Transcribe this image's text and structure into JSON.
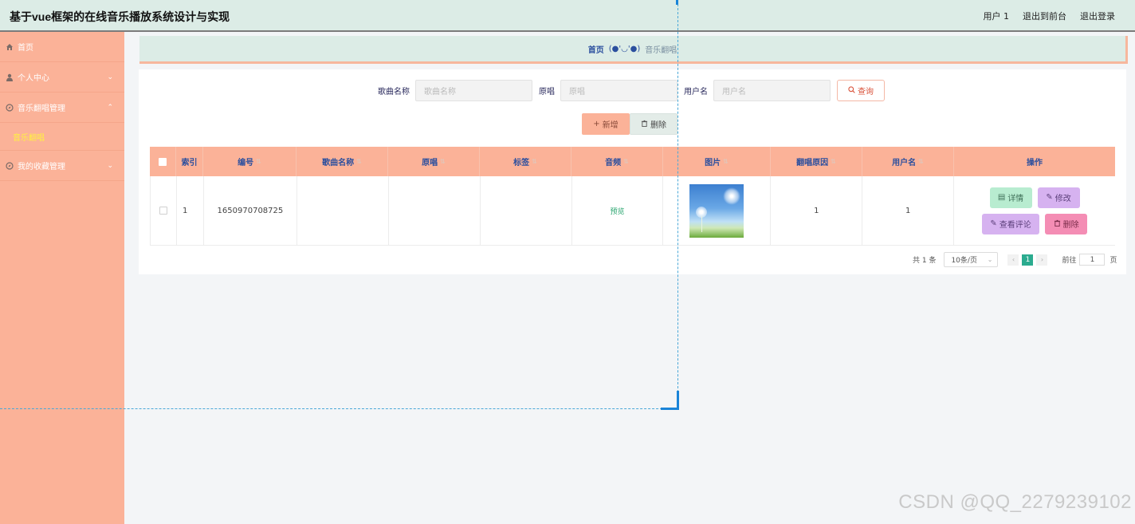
{
  "header": {
    "title": "基于vue框架的在线音乐播放系统设计与实现",
    "user": "用户 1",
    "to_front": "退出到前台",
    "logout": "退出登录"
  },
  "sidebar": {
    "items": [
      {
        "label": "首页",
        "icon": "home-icon"
      },
      {
        "label": "个人中心",
        "icon": "user-icon"
      },
      {
        "label": "音乐翻唱管理",
        "icon": "compass-icon"
      },
      {
        "label": "音乐翻唱",
        "icon": ""
      },
      {
        "label": "我的收藏管理",
        "icon": "compass-icon"
      }
    ]
  },
  "breadcrumb": {
    "home": "首页",
    "separator": "(●'◡'●)",
    "current": "音乐翻唱"
  },
  "search": {
    "song_label": "歌曲名称",
    "song_placeholder": "歌曲名称",
    "original_label": "原唱",
    "original_placeholder": "原唱",
    "user_label": "用户名",
    "user_placeholder": "用户名",
    "query_label": "查询"
  },
  "actions": {
    "add_label": "新增",
    "delete_label": "删除"
  },
  "table": {
    "columns": [
      "索引",
      "编号",
      "歌曲名称",
      "原唱",
      "标签",
      "音频",
      "图片",
      "翻唱原因",
      "用户名",
      "操作"
    ],
    "rows": [
      {
        "index": "1",
        "number": "1650970708725",
        "song": "",
        "original": "",
        "tag": "",
        "audio": "预览",
        "reason": "1",
        "username": "1"
      }
    ],
    "ops": {
      "detail": "详情",
      "edit": "修改",
      "comment": "查看评论",
      "delete": "删除"
    }
  },
  "pagination": {
    "total": "共 1 条",
    "page_size": "10条/页",
    "current_page": "1",
    "goto": "前往",
    "goto_value": "1",
    "page_suffix": "页"
  },
  "watermark": "CSDN @QQ_2279239102",
  "colors": {
    "header_bg": "#dcece6",
    "sidebar_bg": "#fbb298",
    "accent_green": "#2bab8f",
    "submenu_active": "#fff23f"
  }
}
